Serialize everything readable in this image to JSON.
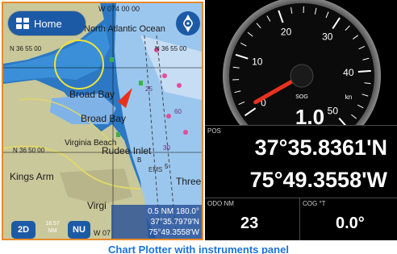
{
  "map": {
    "home_label": "Home",
    "labels": {
      "top_coord": "W 074 00 00",
      "north_atlantic": "North Atlantic Ocean",
      "lat_left": "N 36 55 00",
      "lat_right": "N 36 55 00",
      "broad_bay": "Broad Bay",
      "broad_bay_2": "Broad Bay",
      "virginia_beach": "Virginia Beach",
      "rudee_inlet": "Rudee Inlet",
      "lat_mid": "N 36 50 00",
      "kings_arm": "Kings Arm",
      "three": "Three",
      "virginia_bottom": "Virgi",
      "bottom_coord": "W 07",
      "depth_25": "25",
      "depth_60": "60",
      "depth_30": "30",
      "marker_b": "B",
      "marker_5": "5",
      "marker_ems": "EMS"
    },
    "mode_label": "2D",
    "scale_value": "18.57",
    "scale_unit": "NM",
    "north_label": "NU",
    "cursor_range": "0.5 NM 180.0°",
    "cursor_lat": "37°35.7979'N",
    "cursor_lon": "75°49.3558'W"
  },
  "gauge": {
    "ticks": [
      "0",
      "10",
      "20",
      "30",
      "40",
      "50"
    ],
    "label": "SOG",
    "unit": "kn",
    "value": "1.0",
    "needle_value": 1.0,
    "max": 55
  },
  "position": {
    "label": "POS",
    "lat": "37°35.8361'N",
    "lon": "75°49.3558'W"
  },
  "odometer": {
    "label": "ODO NM",
    "value": "23"
  },
  "cog": {
    "label": "COG °T",
    "value": "0.0°"
  },
  "caption": "Chart Plotter with instruments panel",
  "colors": {
    "map_frame": "#e8892a",
    "water_deep": "#2c78c4",
    "land": "#c9c89a",
    "button_blue": "#1c5aa6",
    "needle": "#e8321e",
    "caption": "#1a73d9"
  }
}
